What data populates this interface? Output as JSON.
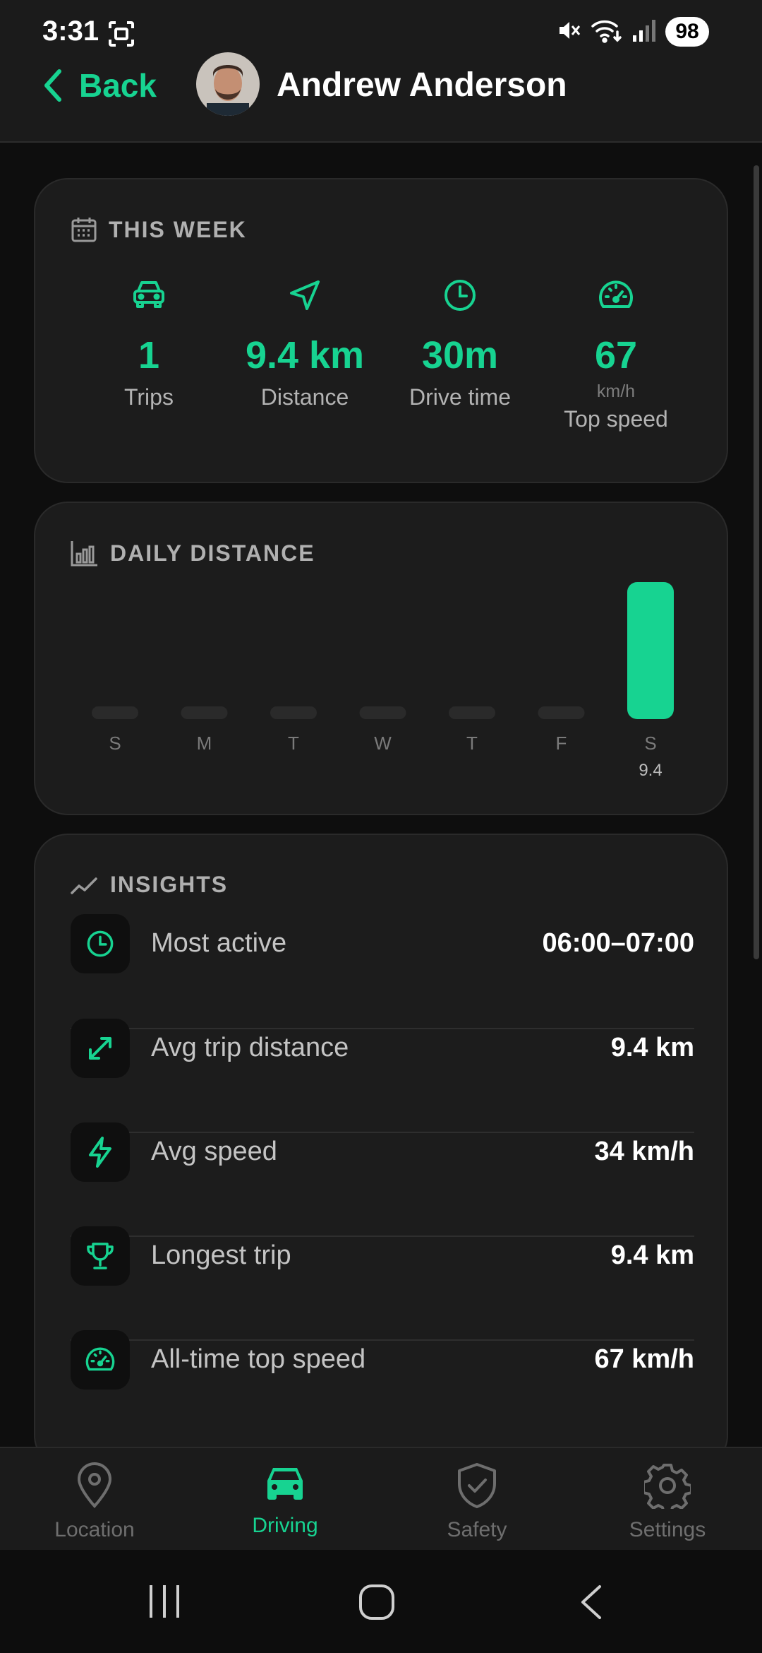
{
  "status_bar": {
    "time": "3:31",
    "battery": "98"
  },
  "header": {
    "back_label": "Back",
    "user_name": "Andrew Anderson"
  },
  "this_week": {
    "title": "THIS WEEK",
    "stats": [
      {
        "icon": "car-icon",
        "value": "1",
        "unit": "",
        "label": "Trips"
      },
      {
        "icon": "navigation-arrow-icon",
        "value": "9.4 km",
        "unit": "",
        "label": "Distance"
      },
      {
        "icon": "clock-icon",
        "value": "30m",
        "unit": "",
        "label": "Drive time"
      },
      {
        "icon": "speedometer-icon",
        "value": "67",
        "unit": "km/h",
        "label": "Top speed"
      }
    ]
  },
  "daily_distance": {
    "title": "DAILY DISTANCE",
    "chart_data": {
      "type": "bar",
      "categories": [
        "S",
        "M",
        "T",
        "W",
        "T",
        "F",
        "S"
      ],
      "values": [
        0,
        0,
        0,
        0,
        0,
        0,
        9.4
      ],
      "value_labels": [
        "",
        "",
        "",
        "",
        "",
        "",
        "9.4"
      ],
      "title": "DAILY DISTANCE",
      "xlabel": "",
      "ylabel": "",
      "grid": false,
      "bar_color": "#17d391",
      "empty_bar_color": "#2a2a2a"
    }
  },
  "insights": {
    "title": "INSIGHTS",
    "rows": [
      {
        "icon": "clock-icon",
        "label": "Most active",
        "value": "06:00–07:00"
      },
      {
        "icon": "expand-arrows-icon",
        "label": "Avg trip distance",
        "value": "9.4 km"
      },
      {
        "icon": "lightning-icon",
        "label": "Avg speed",
        "value": "34 km/h"
      },
      {
        "icon": "trophy-icon",
        "label": "Longest trip",
        "value": "9.4 km"
      },
      {
        "icon": "speedometer-icon",
        "label": "All-time top speed",
        "value": "67 km/h"
      }
    ]
  },
  "bottom_nav": {
    "items": [
      {
        "icon": "location-pin-icon",
        "label": "Location",
        "active": false
      },
      {
        "icon": "car-icon",
        "label": "Driving",
        "active": true
      },
      {
        "icon": "shield-check-icon",
        "label": "Safety",
        "active": false
      },
      {
        "icon": "gear-icon",
        "label": "Settings",
        "active": false
      }
    ]
  },
  "colors": {
    "accent": "#17d391",
    "background": "#0e0e0e",
    "card": "#1c1c1c",
    "muted_text": "#b0b0b0"
  }
}
